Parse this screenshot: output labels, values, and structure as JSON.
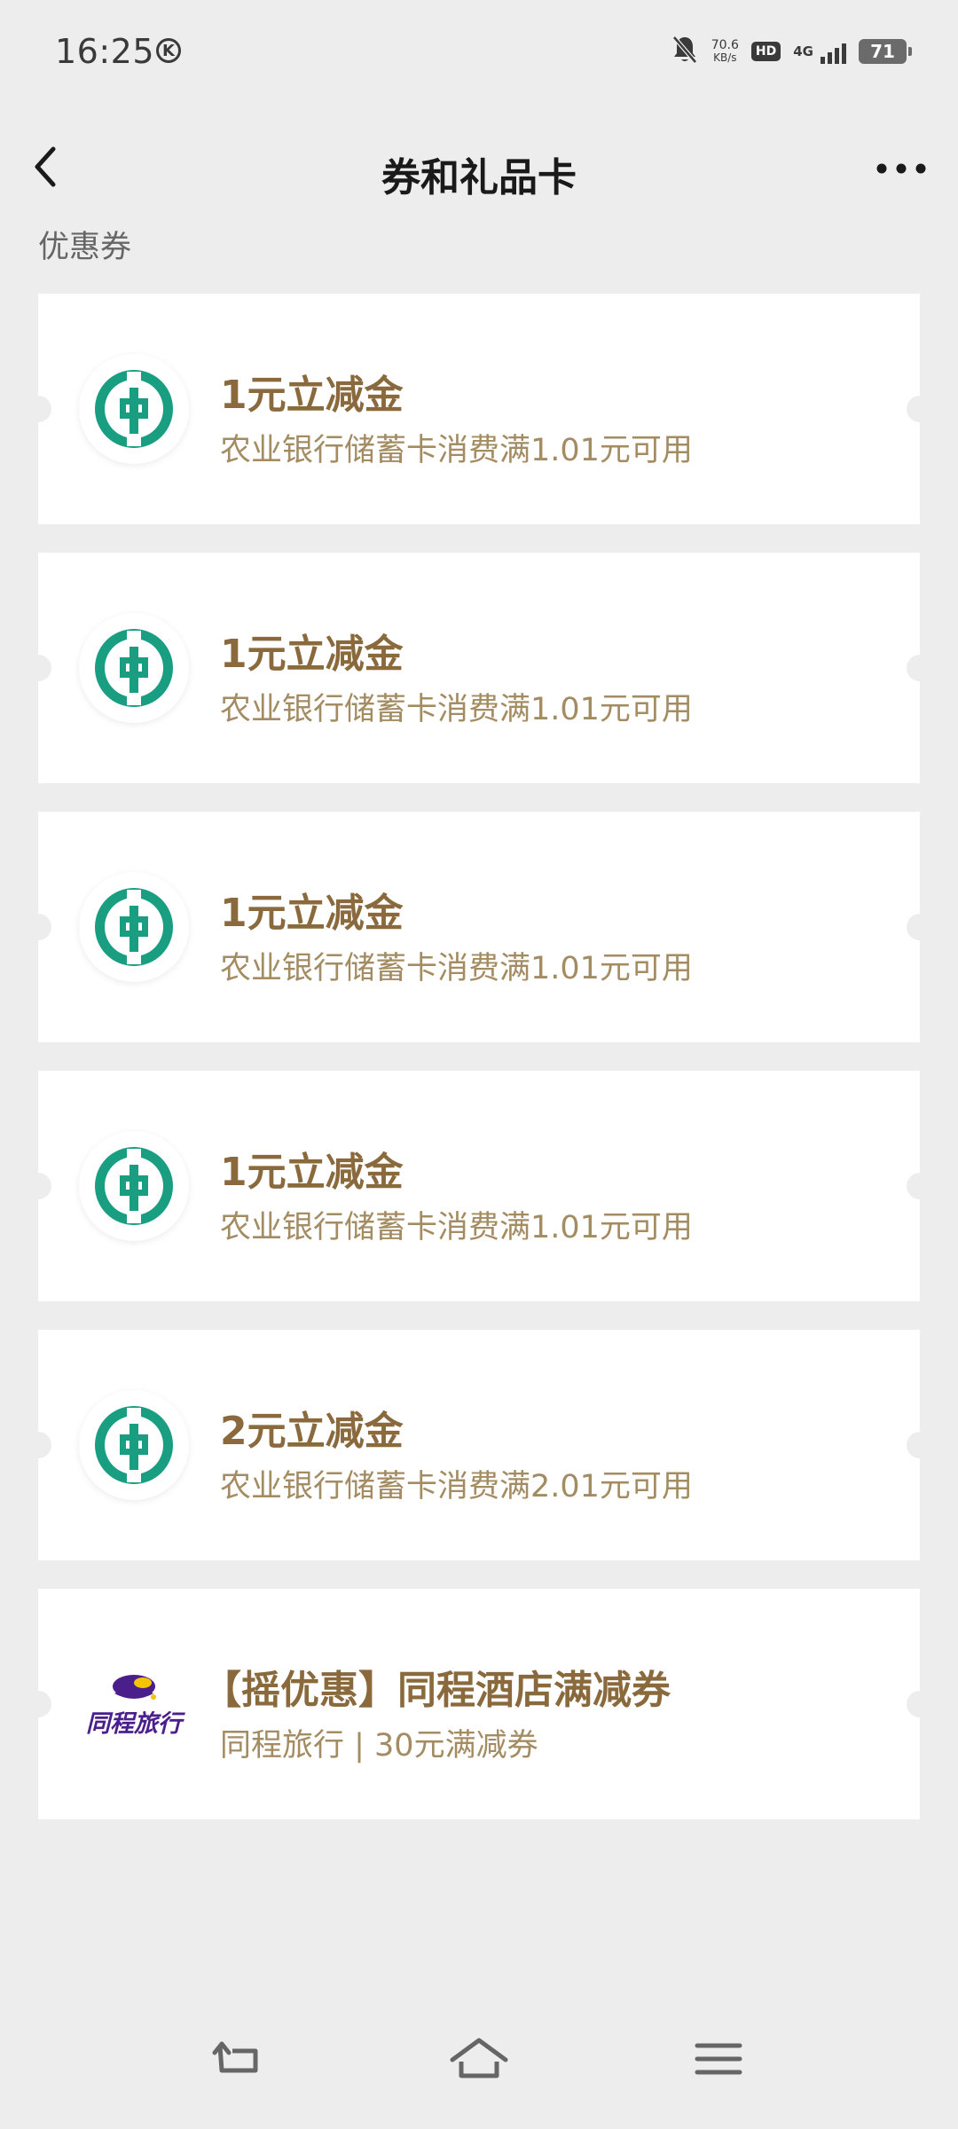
{
  "status_bar": {
    "time": "16:25",
    "k_badge": "K",
    "net_speed_value": "70.6",
    "net_speed_unit": "KB/s",
    "hd_label": "HD",
    "network_type": "4G",
    "battery": "71"
  },
  "nav": {
    "title": "券和礼品卡",
    "back_icon": "chevron-left-icon",
    "more_icon": "more-dots-icon"
  },
  "section": {
    "label": "优惠券"
  },
  "coupons": [
    {
      "title": "1元立减金",
      "desc": "农业银行储蓄卡消费满1.01元可用",
      "logo": "abc-bank-logo"
    },
    {
      "title": "1元立减金",
      "desc": "农业银行储蓄卡消费满1.01元可用",
      "logo": "abc-bank-logo"
    },
    {
      "title": "1元立减金",
      "desc": "农业银行储蓄卡消费满1.01元可用",
      "logo": "abc-bank-logo"
    },
    {
      "title": "1元立减金",
      "desc": "农业银行储蓄卡消费满1.01元可用",
      "logo": "abc-bank-logo"
    },
    {
      "title": "2元立减金",
      "desc": "农业银行储蓄卡消费满2.01元可用",
      "logo": "abc-bank-logo"
    },
    {
      "title": "【摇优惠】同程酒店满减券",
      "desc": "同程旅行 | 30元满减券",
      "logo": "tongcheng-logo",
      "logo_text": "同程旅行"
    }
  ],
  "colors": {
    "background": "#ededed",
    "card": "#ffffff",
    "coupon_title": "#8a6a3d",
    "coupon_desc": "#a48c62",
    "abc_green": "#1a9e82",
    "tongcheng_purple": "#4a1f8c",
    "tongcheng_yellow": "#f5c400"
  }
}
